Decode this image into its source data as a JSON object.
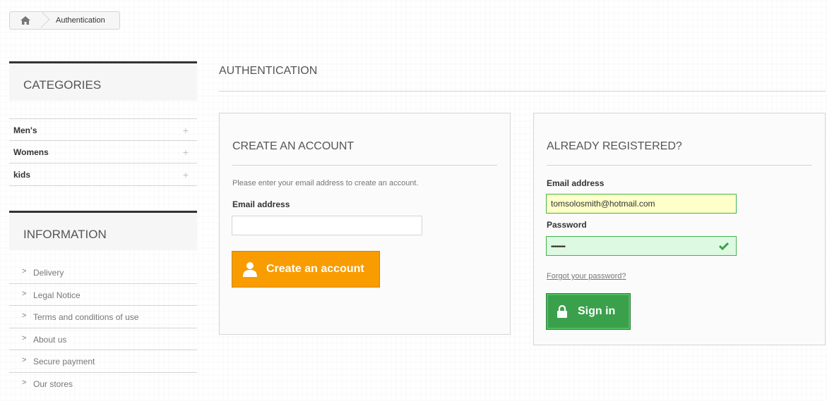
{
  "breadcrumb": {
    "home_icon": "home-icon",
    "current": "Authentication"
  },
  "sidebar": {
    "categories_title": "CATEGORIES",
    "categories": [
      {
        "label": "Men's",
        "icon": "plus-icon"
      },
      {
        "label": "Womens",
        "icon": "plus-icon"
      },
      {
        "label": "kids",
        "icon": "plus-icon"
      }
    ],
    "information_title": "INFORMATION",
    "information": [
      {
        "label": "Delivery",
        "icon": "chevron-right-icon"
      },
      {
        "label": "Legal Notice",
        "icon": "chevron-right-icon"
      },
      {
        "label": "Terms and conditions of use",
        "icon": "chevron-right-icon"
      },
      {
        "label": "About us",
        "icon": "chevron-right-icon"
      },
      {
        "label": "Secure payment",
        "icon": "chevron-right-icon"
      },
      {
        "label": "Our stores",
        "icon": "chevron-right-icon"
      }
    ]
  },
  "main": {
    "heading": "AUTHENTICATION",
    "create": {
      "title": "CREATE AN ACCOUNT",
      "description": "Please enter your email address to create an account.",
      "email_label": "Email address",
      "email_value": "",
      "button_label": "Create an account",
      "button_icon": "user-icon",
      "button_color": "#f99c00"
    },
    "login": {
      "title": "ALREADY REGISTERED?",
      "email_label": "Email address",
      "email_value": "tomsolosmith@hotmail.com",
      "password_label": "Password",
      "password_value": "••••••••",
      "valid_icon": "check-icon",
      "forgot_link": "Forgot your password?",
      "button_label": "Sign in",
      "button_icon": "lock-icon",
      "button_color": "#3aa04c"
    }
  }
}
